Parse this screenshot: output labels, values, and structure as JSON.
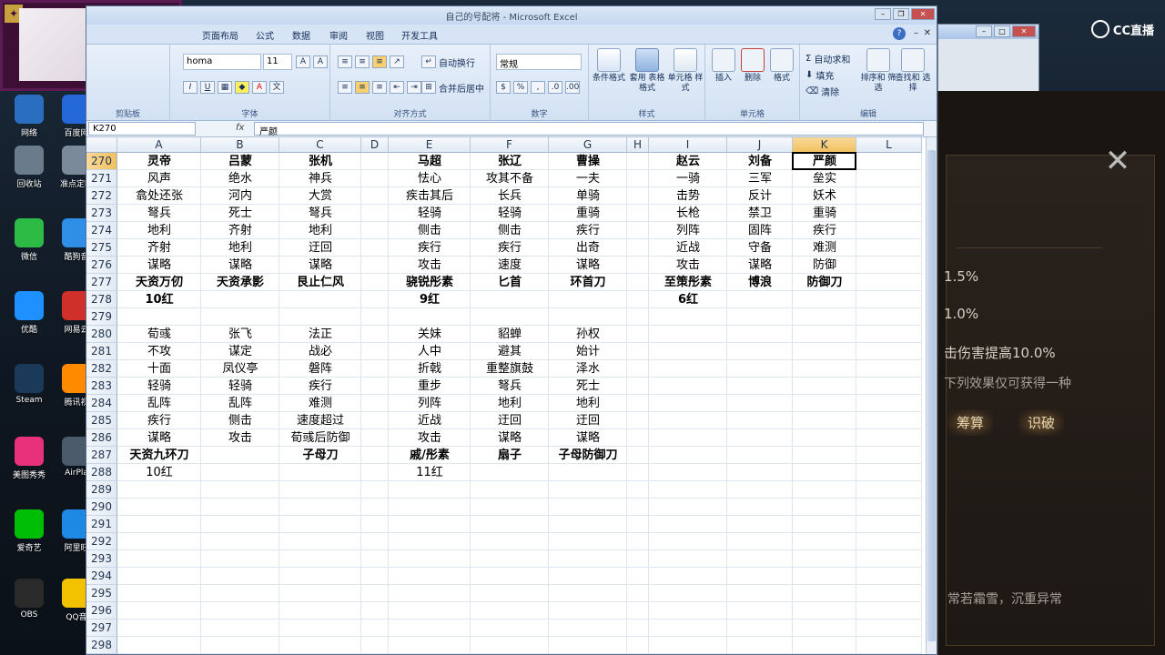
{
  "desktop": {
    "icons_left": [
      {
        "label": "网络",
        "color": "#2a6fbf",
        "icon": "network-icon"
      },
      {
        "label": "回收站",
        "color": "#6a7c8c",
        "icon": "recycle-bin-icon"
      },
      {
        "label": "微信",
        "color": "#2dbb46",
        "icon": "wechat-icon"
      },
      {
        "label": "优酷",
        "color": "#1e90ff",
        "icon": "youku-icon"
      },
      {
        "label": "Steam",
        "color": "#1b3a5a",
        "icon": "steam-icon"
      },
      {
        "label": "美图秀秀",
        "color": "#e8317a",
        "icon": "meitu-icon"
      },
      {
        "label": "爱奇艺",
        "color": "#00be06",
        "icon": "iqiyi-icon"
      },
      {
        "label": "OBS",
        "color": "#2a2a2a",
        "icon": "obs-icon"
      }
    ],
    "icons_right": [
      {
        "label": "百度网",
        "color": "#2468d8",
        "icon": "baidu-icon"
      },
      {
        "label": "准点定时",
        "color": "#7a8a9a",
        "icon": "clock-icon"
      },
      {
        "label": "酷狗音",
        "color": "#2f8ee6",
        "icon": "kugou-icon"
      },
      {
        "label": "网易云",
        "color": "#d0302a",
        "icon": "netease-music-icon"
      },
      {
        "label": "腾讯视",
        "color": "#ff8a00",
        "icon": "tencent-video-icon"
      },
      {
        "label": "AirPla",
        "color": "#4a5a6a",
        "icon": "airplay-icon"
      },
      {
        "label": "阿里旺",
        "color": "#1e88e5",
        "icon": "aliwangwang-icon"
      },
      {
        "label": "QQ音",
        "color": "#f2c200",
        "icon": "qq-music-icon"
      }
    ]
  },
  "watermark": {
    "text": "CC直播"
  },
  "game": {
    "texts": [
      "1.5%",
      "1.0%",
      "击伤害提高10.0%",
      "下列效果仅可获得一种"
    ],
    "buttons": [
      "筹算",
      "识破"
    ],
    "footer": "常若霜雪，沉重异常"
  },
  "excel": {
    "title": "自己的号配将 - Microsoft Excel",
    "tabs": [
      "页面布局",
      "公式",
      "数据",
      "审阅",
      "视图",
      "开发工具"
    ],
    "ribbon": {
      "font_name": "Tahoma",
      "font_name_display": "homa",
      "font_size": "11",
      "wrap_text": "自动换行",
      "merge_center": "合并后居中",
      "number_format": "常规",
      "cond_format": "条件格式",
      "table_format": "套用\n表格格式",
      "cell_style": "单元格\n样式",
      "insert": "插入",
      "delete": "删除",
      "format": "格式",
      "autosum": "自动求和",
      "fill": "填充",
      "clear": "清除",
      "sort_filter": "排序和\n筛选",
      "find_select": "查找和\n选择",
      "groups": [
        "剪贴板",
        "字体",
        "对齐方式",
        "数字",
        "样式",
        "单元格",
        "编辑"
      ]
    },
    "name_box": "K270",
    "fx_label": "fx",
    "formula_value": "严颜",
    "columns": [
      "A",
      "B",
      "C",
      "D",
      "E",
      "F",
      "G",
      "H",
      "I",
      "J",
      "K",
      "L"
    ],
    "selected_column": "K",
    "selected_row": "270",
    "rows": [
      {
        "num": "270",
        "bold": true,
        "cells": [
          "灵帝",
          "吕蒙",
          "张机",
          "",
          "马超",
          "张辽",
          "曹操",
          "",
          "赵云",
          "刘备",
          "严颜",
          ""
        ]
      },
      {
        "num": "271",
        "bold": false,
        "cells": [
          "风声",
          "绝水",
          "神兵",
          "",
          "怯心",
          "攻其不备",
          "一夫",
          "",
          "一骑",
          "三军",
          "垒实",
          ""
        ]
      },
      {
        "num": "272",
        "bold": false,
        "cells": [
          "翕处还张",
          "河内",
          "大赏",
          "",
          "疾击其后",
          "长兵",
          "单骑",
          "",
          "击势",
          "反计",
          "妖术",
          ""
        ]
      },
      {
        "num": "273",
        "bold": false,
        "cells": [
          "弩兵",
          "死士",
          "弩兵",
          "",
          "轻骑",
          "轻骑",
          "重骑",
          "",
          "长枪",
          "禁卫",
          "重骑",
          ""
        ]
      },
      {
        "num": "274",
        "bold": false,
        "cells": [
          "地利",
          "齐射",
          "地利",
          "",
          "侧击",
          "侧击",
          "疾行",
          "",
          "列阵",
          "固阵",
          "疾行",
          ""
        ]
      },
      {
        "num": "275",
        "bold": false,
        "cells": [
          "齐射",
          "地利",
          "迂回",
          "",
          "疾行",
          "疾行",
          "出奇",
          "",
          "近战",
          "守备",
          "难测",
          ""
        ]
      },
      {
        "num": "276",
        "bold": false,
        "cells": [
          "谋略",
          "谋略",
          "谋略",
          "",
          "攻击",
          "速度",
          "谋略",
          "",
          "攻击",
          "谋略",
          "防御",
          ""
        ]
      },
      {
        "num": "277",
        "bold": true,
        "cells": [
          "天资万仞",
          "天资承影",
          "艮止仁风",
          "",
          "骁锐彤素",
          "匕首",
          "环首刀",
          "",
          "至策彤素",
          "博浪",
          "防御刀",
          ""
        ]
      },
      {
        "num": "278",
        "bold": true,
        "cells": [
          "10红",
          "",
          "",
          "",
          "9红",
          "",
          "",
          "",
          "6红",
          "",
          "",
          ""
        ]
      },
      {
        "num": "279",
        "bold": false,
        "cells": [
          "",
          "",
          "",
          "",
          "",
          "",
          "",
          "",
          "",
          "",
          "",
          ""
        ]
      },
      {
        "num": "280",
        "bold": false,
        "cells": [
          "荀彧",
          "张飞",
          "法正",
          "",
          "关妹",
          "貂蝉",
          "孙权",
          "",
          "",
          "",
          "",
          ""
        ]
      },
      {
        "num": "281",
        "bold": false,
        "cells": [
          "不攻",
          "谋定",
          "战必",
          "",
          "人中",
          "避其",
          "始计",
          "",
          "",
          "",
          "",
          ""
        ]
      },
      {
        "num": "282",
        "bold": false,
        "cells": [
          "十面",
          "凤仪亭",
          "磐阵",
          "",
          "折戟",
          "重整旗鼓",
          "泽水",
          "",
          "",
          "",
          "",
          ""
        ]
      },
      {
        "num": "283",
        "bold": false,
        "cells": [
          "轻骑",
          "轻骑",
          "疾行",
          "",
          "重步",
          "弩兵",
          "死士",
          "",
          "",
          "",
          "",
          ""
        ]
      },
      {
        "num": "284",
        "bold": false,
        "cells": [
          "乱阵",
          "乱阵",
          "难测",
          "",
          "列阵",
          "地利",
          "地利",
          "",
          "",
          "",
          "",
          ""
        ]
      },
      {
        "num": "285",
        "bold": false,
        "cells": [
          "疾行",
          "侧击",
          "速度超过",
          "",
          "近战",
          "迂回",
          "迂回",
          "",
          "",
          "",
          "",
          ""
        ]
      },
      {
        "num": "286",
        "bold": false,
        "cells": [
          "谋略",
          "攻击",
          "荀彧后防御",
          "",
          "攻击",
          "谋略",
          "谋略",
          "",
          "",
          "",
          "",
          ""
        ]
      },
      {
        "num": "287",
        "bold": true,
        "cells": [
          "天资九环刀",
          "",
          "子母刀",
          "",
          "戚/彤素",
          "扇子",
          "子母防御刀",
          "",
          "",
          "",
          "",
          ""
        ]
      },
      {
        "num": "288",
        "bold": false,
        "cells": [
          "10红",
          "",
          "",
          "",
          "11红",
          "",
          "",
          "",
          "",
          "",
          "",
          ""
        ]
      },
      {
        "num": "289",
        "bold": false,
        "cells": [
          "",
          "",
          "",
          "",
          "",
          "",
          "",
          "",
          "",
          "",
          "",
          ""
        ]
      },
      {
        "num": "290",
        "bold": false,
        "cells": [
          "",
          "",
          "",
          "",
          "",
          "",
          "",
          "",
          "",
          "",
          "",
          ""
        ]
      },
      {
        "num": "291",
        "bold": false,
        "cells": [
          "",
          "",
          "",
          "",
          "",
          "",
          "",
          "",
          "",
          "",
          "",
          ""
        ]
      },
      {
        "num": "292",
        "bold": false,
        "cells": [
          "",
          "",
          "",
          "",
          "",
          "",
          "",
          "",
          "",
          "",
          "",
          ""
        ]
      },
      {
        "num": "293",
        "bold": false,
        "cells": [
          "",
          "",
          "",
          "",
          "",
          "",
          "",
          "",
          "",
          "",
          "",
          ""
        ]
      },
      {
        "num": "294",
        "bold": false,
        "cells": [
          "",
          "",
          "",
          "",
          "",
          "",
          "",
          "",
          "",
          "",
          "",
          ""
        ]
      },
      {
        "num": "295",
        "bold": false,
        "cells": [
          "",
          "",
          "",
          "",
          "",
          "",
          "",
          "",
          "",
          "",
          "",
          ""
        ]
      },
      {
        "num": "296",
        "bold": false,
        "cells": [
          "",
          "",
          "",
          "",
          "",
          "",
          "",
          "",
          "",
          "",
          "",
          ""
        ]
      },
      {
        "num": "297",
        "bold": false,
        "cells": [
          "",
          "",
          "",
          "",
          "",
          "",
          "",
          "",
          "",
          "",
          "",
          ""
        ]
      },
      {
        "num": "298",
        "bold": false,
        "cells": [
          "",
          "",
          "",
          "",
          "",
          "",
          "",
          "",
          "",
          "",
          "",
          ""
        ]
      }
    ]
  }
}
